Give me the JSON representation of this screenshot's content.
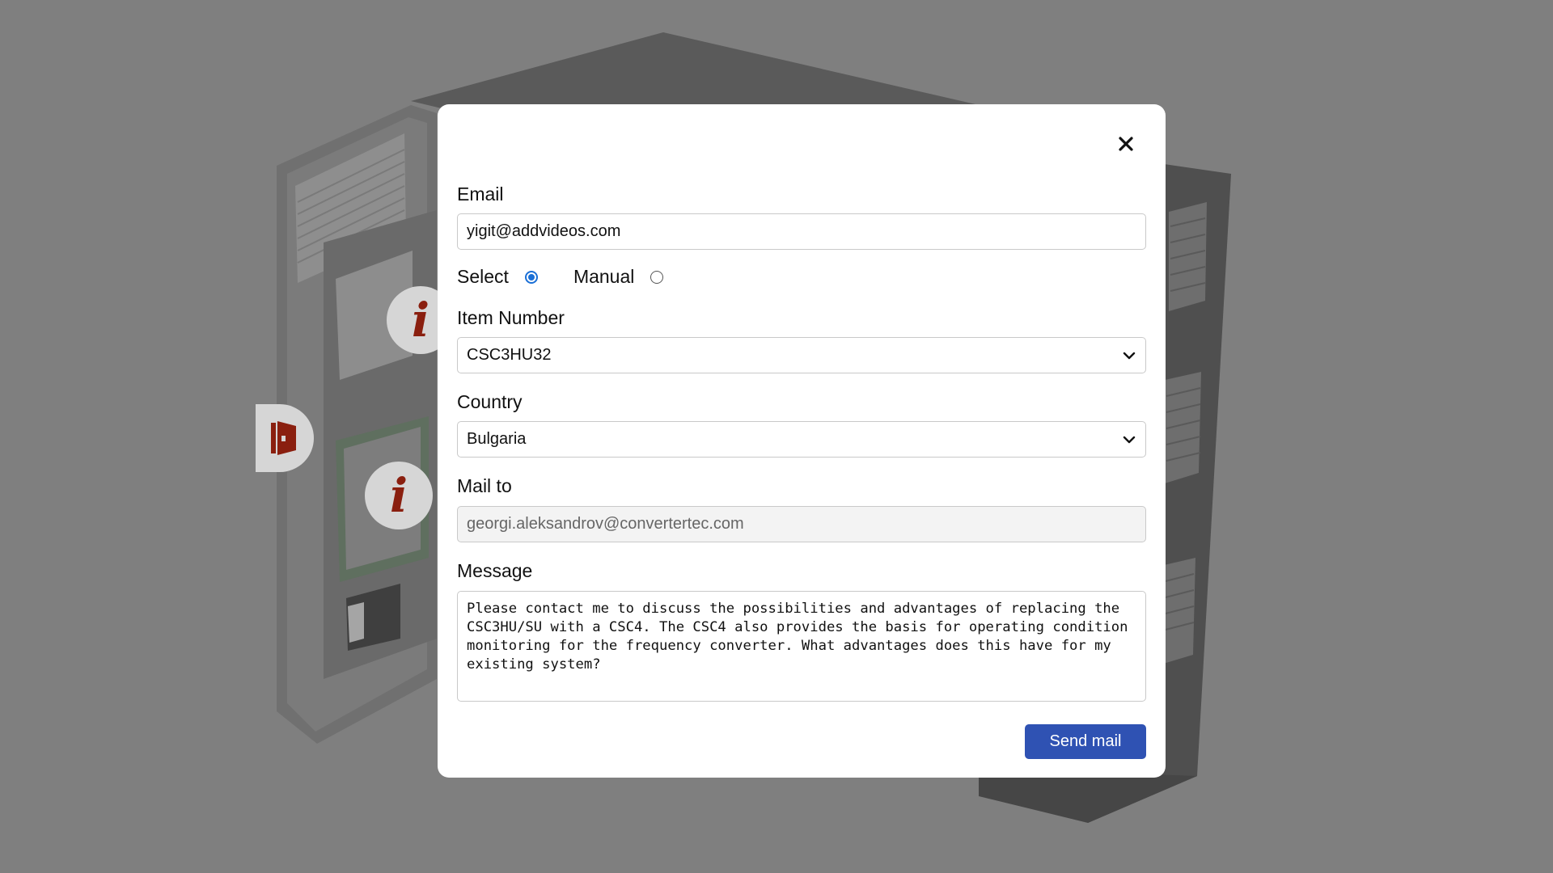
{
  "form": {
    "email_label": "Email",
    "email_value": "yigit@addvideos.com",
    "mode_select_label": "Select",
    "mode_manual_label": "Manual",
    "mode_selected": "Select",
    "item_number_label": "Item Number",
    "item_number_value": "CSC3HU32",
    "country_label": "Country",
    "country_value": "Bulgaria",
    "mail_to_label": "Mail to",
    "mail_to_value": "georgi.aleksandrov@convertertec.com",
    "message_label": "Message",
    "message_value": "Please contact me to discuss the possibilities and advantages of replacing the CSC3HU/SU with a CSC4. The CSC4 also provides the basis for operating condition monitoring for the frequency converter. What advantages does this have for my existing system?",
    "send_label": "Send mail"
  },
  "background": {
    "info_hotspot_glyph": "i",
    "accent_color": "#8a1f0f"
  },
  "icons": {
    "close": "close-icon",
    "chevron": "chevron-down-icon",
    "door": "door-exit-icon",
    "info": "info-icon"
  },
  "colors": {
    "overlay": "#7f7f7f",
    "primary_button": "#2f52b3",
    "radio_checked": "#1a6fd6"
  }
}
